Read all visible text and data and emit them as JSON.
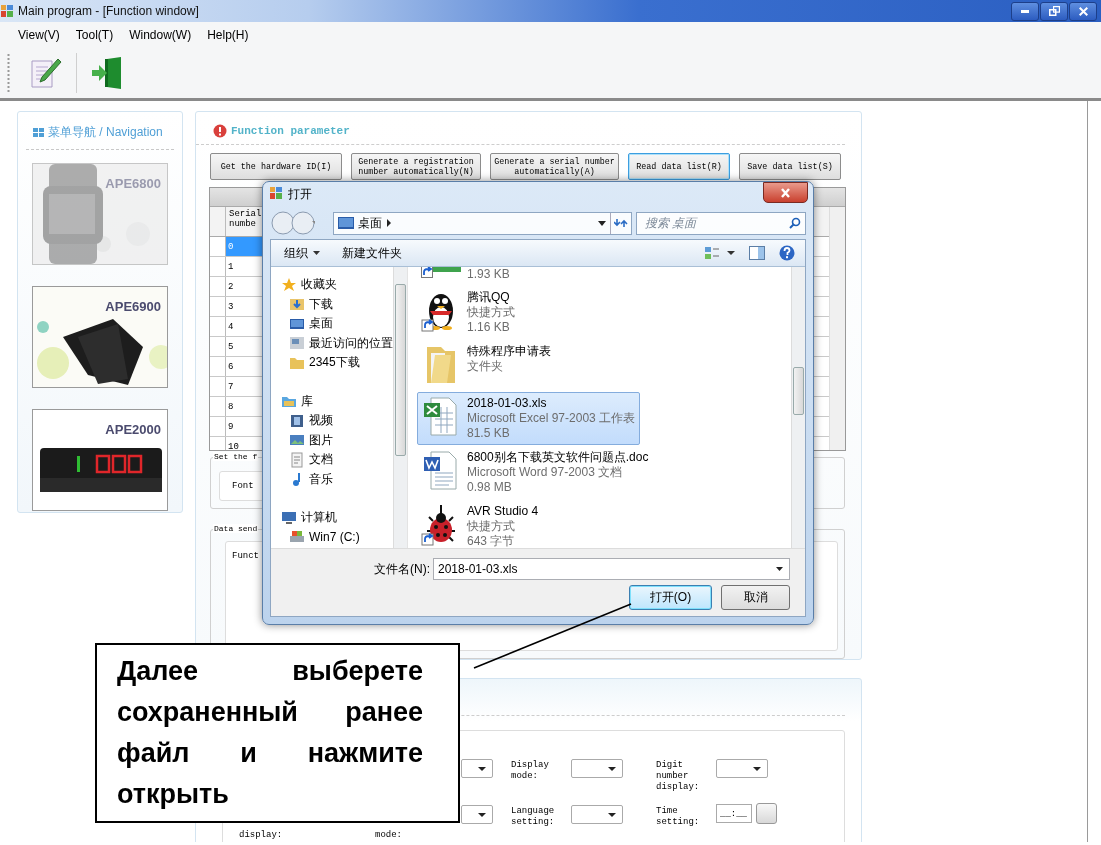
{
  "window": {
    "title": "Main program - [Function window]"
  },
  "menu": [
    "View(V)",
    "Tool(T)",
    "Window(W)",
    "Help(H)"
  ],
  "navigation": {
    "title": "菜单导航 / Navigation",
    "items": [
      {
        "label": "APE6800",
        "kind": "watch",
        "selected": true
      },
      {
        "label": "APE6900",
        "kind": "band",
        "selected": false
      },
      {
        "label": "APE2000",
        "kind": "display",
        "selected": false
      }
    ]
  },
  "function_panel": {
    "title": "Function parameter",
    "buttons": [
      {
        "label": "Get the hardware ID(I)",
        "focused": false
      },
      {
        "label": "Generate a registration number automatically(N)",
        "focused": false
      },
      {
        "label": "Generate a serial number automatically(A)",
        "focused": false
      },
      {
        "label": "Read data list(R)",
        "focused": true
      },
      {
        "label": "Save data list(S)",
        "focused": false
      }
    ],
    "table": {
      "columns": [
        "Serial numbe"
      ],
      "rows": [
        {
          "cell": "0",
          "selected": true
        },
        {
          "cell": "1",
          "selected": false
        },
        {
          "cell": "2",
          "selected": false
        },
        {
          "cell": "3",
          "selected": false
        },
        {
          "cell": "4",
          "selected": false
        },
        {
          "cell": "5",
          "selected": false
        },
        {
          "cell": "6",
          "selected": false
        },
        {
          "cell": "7",
          "selected": false
        },
        {
          "cell": "8",
          "selected": false
        },
        {
          "cell": "9",
          "selected": false
        },
        {
          "cell": "10",
          "selected": false
        }
      ]
    },
    "font_group": {
      "title": "Set the f",
      "label": "Font"
    },
    "send_group": {
      "title": "Data send",
      "label": "Funct"
    }
  },
  "settings_panel": {
    "rows": [
      [
        {
          "kind": "none"
        },
        {
          "kind": "select"
        },
        {
          "label": "Display mode:",
          "kind": "select"
        },
        {
          "label": "Digit number display:",
          "kind": "select"
        }
      ],
      [
        {
          "label": "display:",
          "kind": "none"
        },
        {
          "label": "mode:",
          "kind": "select"
        },
        {
          "label": "Language setting:",
          "kind": "select"
        },
        {
          "label": "Time setting:",
          "kind": "time",
          "value": "__:__"
        }
      ]
    ]
  },
  "dialog": {
    "title": "打开",
    "path": "桌面",
    "search": {
      "placeholder": "搜索 桌面"
    },
    "commands": [
      "组织",
      "新建文件夹"
    ],
    "sidebar": [
      {
        "label": "收藏夹",
        "kind": "star",
        "children": [
          {
            "label": "下载",
            "kind": "download"
          },
          {
            "label": "桌面",
            "kind": "desktop"
          },
          {
            "label": "最近访问的位置",
            "kind": "recent"
          },
          {
            "label": "2345下载",
            "kind": "folder"
          }
        ]
      },
      {
        "label": "库",
        "kind": "library",
        "children": [
          {
            "label": "视频",
            "kind": "video"
          },
          {
            "label": "图片",
            "kind": "picture"
          },
          {
            "label": "文档",
            "kind": "document"
          },
          {
            "label": "音乐",
            "kind": "music"
          }
        ]
      },
      {
        "label": "计算机",
        "kind": "computer",
        "children": [
          {
            "label": "Win7 (C:)",
            "kind": "drive"
          }
        ]
      }
    ],
    "files": [
      {
        "size": "1.93 KB",
        "kind": "program",
        "shortcut": true,
        "selected": false
      },
      {
        "name": "腾讯QQ",
        "type": "快捷方式",
        "size": "1.16 KB",
        "kind": "penguin",
        "shortcut": true,
        "selected": false
      },
      {
        "name": "特殊程序申请表",
        "type": "文件夹",
        "kind": "folder",
        "shortcut": false,
        "selected": false
      },
      {
        "name": "2018-01-03.xls",
        "type": "Microsoft Excel 97-2003 工作表",
        "size": "81.5 KB",
        "kind": "excel",
        "shortcut": false,
        "selected": true
      },
      {
        "name": "6800别名下载英文软件问题点.doc",
        "type": "Microsoft Word 97-2003 文档",
        "size": "0.98 MB",
        "kind": "word",
        "shortcut": false,
        "selected": false
      },
      {
        "name": "AVR Studio 4",
        "type": "快捷方式",
        "size": "643 字节",
        "kind": "ladybug",
        "shortcut": true,
        "selected": false
      }
    ],
    "filename": {
      "label": "文件名(N):",
      "value": "2018-01-03.xls"
    },
    "buttons": [
      {
        "label": "打开(O)",
        "focused": true
      },
      {
        "label": "取消",
        "focused": false
      }
    ]
  },
  "callout": {
    "text": "Далее выберете сохраненный ранее файл и нажмите открыть"
  }
}
